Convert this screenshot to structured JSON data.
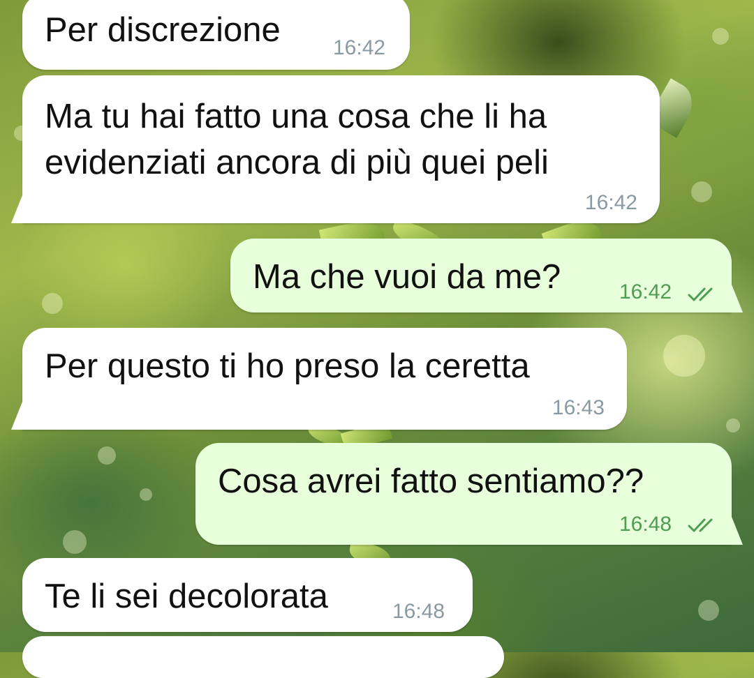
{
  "colors": {
    "incoming_bubble": "#ffffff",
    "outgoing_bubble": "#e7ffdb",
    "incoming_time": "#8a9aa3",
    "outgoing_time": "#4f9d52",
    "read_ticks": "#4f9d52"
  },
  "messages": [
    {
      "direction": "incoming",
      "text": "Per discrezione",
      "time": "16:42"
    },
    {
      "direction": "incoming",
      "text_line1": "Ma tu hai fatto una cosa che li ha",
      "text_line2": "evidenziati ancora di più quei peli",
      "time": "16:42"
    },
    {
      "direction": "outgoing",
      "text": "Ma che vuoi da me?",
      "time": "16:42",
      "status_icon": "double-check-icon"
    },
    {
      "direction": "incoming",
      "text": "Per questo ti ho preso la ceretta",
      "time": "16:43"
    },
    {
      "direction": "outgoing",
      "text": "Cosa avrei fatto sentiamo??",
      "time": "16:48",
      "status_icon": "double-check-icon"
    },
    {
      "direction": "incoming",
      "text": "Te li sei decolorata",
      "time": "16:48"
    }
  ]
}
